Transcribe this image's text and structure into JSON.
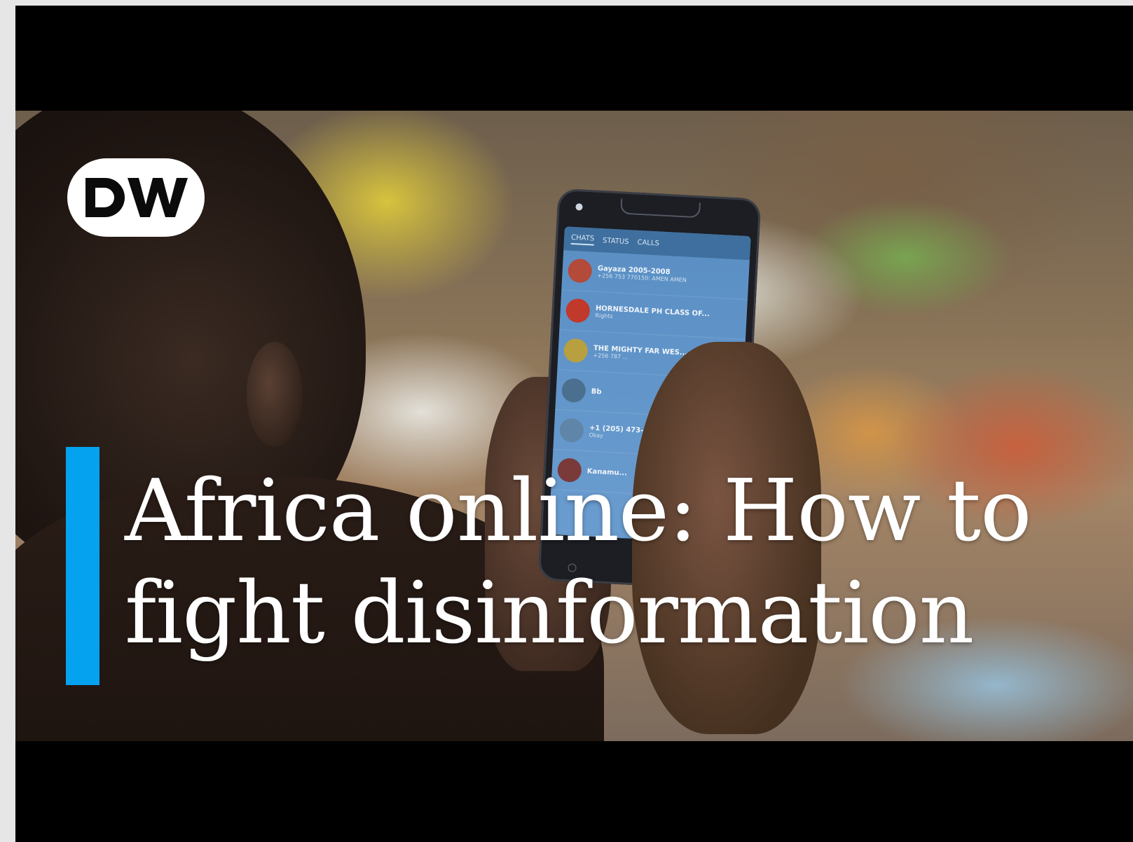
{
  "thumbnail": {
    "logo_text": "DW",
    "title_line1": "Africa online: How to",
    "title_line2": "fight disinformation",
    "accent_color": "#05a2f0",
    "phone_screen": {
      "tabs": [
        "CHATS",
        "STATUS",
        "CALLS"
      ],
      "chats": [
        {
          "name": "Gayaza 2005-2008",
          "preview": "+256 753 770150: AMEN AMEN"
        },
        {
          "name": "HORNESDALE PH CLASS OF...",
          "preview": "Rights"
        },
        {
          "name": "THE MIGHTY FAR WES...",
          "preview": "+256 787 ..."
        },
        {
          "name": "Bb",
          "preview": ""
        },
        {
          "name": "+1 (205) 473-0515",
          "preview": "Okay"
        },
        {
          "name": "Kanamu...",
          "preview": ""
        }
      ]
    }
  }
}
